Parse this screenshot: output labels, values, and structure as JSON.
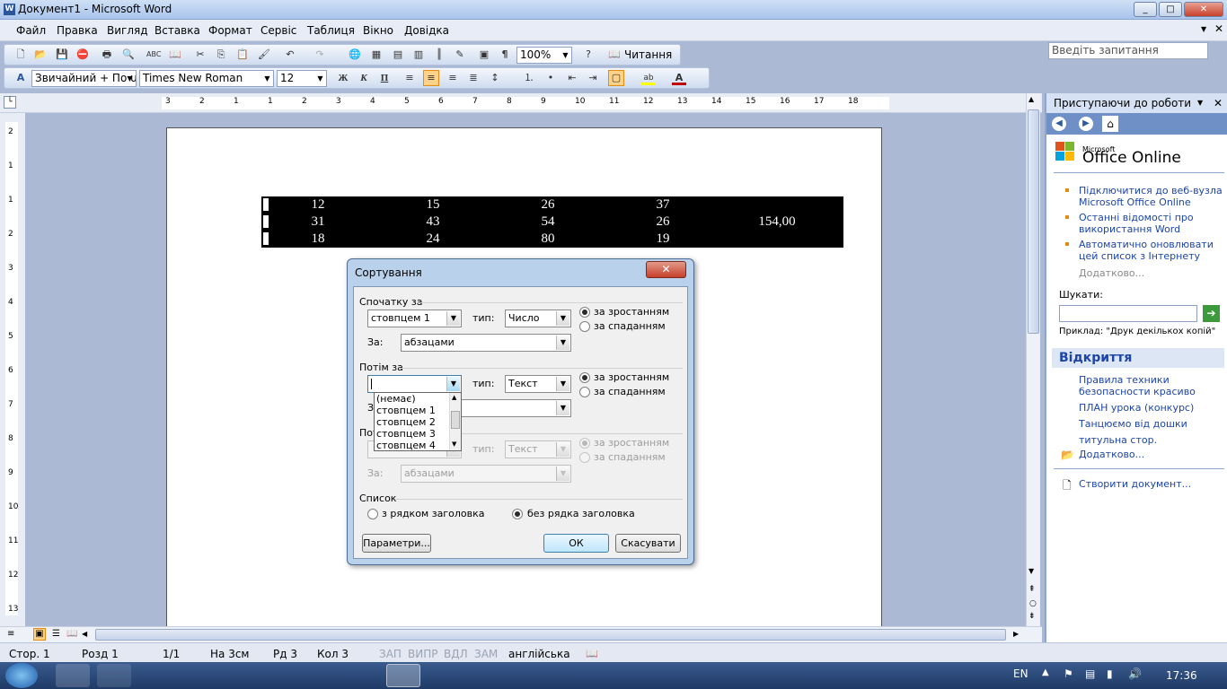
{
  "window": {
    "title": "Документ1 - Microsoft Word"
  },
  "menu": [
    "Файл",
    "Правка",
    "Вигляд",
    "Вставка",
    "Формат",
    "Сервіс",
    "Таблиця",
    "Вікно",
    "Довідка"
  ],
  "ask_box": {
    "placeholder": "Введіть запитання"
  },
  "toolbar": {
    "zoom": "100%",
    "reading": "Читання",
    "style": "Звичайний + По u",
    "font": "Times New Roman",
    "size": "12",
    "bold": "Ж",
    "italic": "К",
    "underline": "П"
  },
  "ruler_labels": [
    "3",
    "2",
    "1",
    "1",
    "2",
    "3",
    "4",
    "5",
    "6",
    "7",
    "8",
    "9",
    "10",
    "11",
    "12",
    "13",
    "14",
    "15",
    "16",
    "17",
    "18"
  ],
  "vruler_labels": [
    "2",
    "1",
    "1",
    "2",
    "3",
    "4",
    "5",
    "6",
    "7",
    "8",
    "9",
    "10",
    "11",
    "12",
    "13"
  ],
  "table": {
    "rows": [
      [
        "12",
        "15",
        "26",
        "37",
        ""
      ],
      [
        "31",
        "43",
        "54",
        "26",
        "154,00"
      ],
      [
        "18",
        "24",
        "80",
        "19",
        ""
      ]
    ]
  },
  "dialog": {
    "title": "Сортування",
    "sort1": {
      "label": "Спочатку за",
      "field": "стовпцем 1",
      "type_label": "тип:",
      "type": "Число",
      "by_label": "За:",
      "by": "абзацами",
      "asc": "за зростанням",
      "desc": "за спаданням"
    },
    "sort2": {
      "label": "Потім за",
      "field": "",
      "type_label": "тип:",
      "type": "Текст",
      "by_label": "З",
      "by": "",
      "asc": "за зростанням",
      "desc": "за спаданням"
    },
    "sort3": {
      "label": "Пот",
      "field": "",
      "type_label": "тип:",
      "type": "Текст",
      "by_label": "За:",
      "by": "абзацами",
      "asc": "за зростанням",
      "desc": "за спаданням"
    },
    "dropdown_options": [
      "(немає)",
      "стовпцем 1",
      "стовпцем 2",
      "стовпцем 3",
      "стовпцем 4"
    ],
    "list": {
      "label": "Список",
      "with_header": "з рядком заголовка",
      "without_header": "без рядка заголовка"
    },
    "buttons": {
      "options": "Параметри...",
      "ok": "ОК",
      "cancel": "Скасувати"
    }
  },
  "taskpane": {
    "title": "Приступаючи до роботи",
    "office_small": "Microsoft",
    "office_big": "Office Online",
    "links": [
      "Підключитися до веб-вузла Microsoft Office Online",
      "Останні відомості про використання Word",
      "Автоматично оновлювати цей список з Інтернету"
    ],
    "more1": "Додатково...",
    "search_label": "Шукати:",
    "example": "Приклад: \"Друк декількох копій\"",
    "open_title": "Відкриття",
    "recent": [
      "Правила техники безопасности красиво",
      "ПЛАН урока (конкурс)",
      "Танцюємо від дошки",
      "титульна стор."
    ],
    "more2": "Додатково...",
    "create": "Створити документ..."
  },
  "status": {
    "page": "Стор. 1",
    "section": "Розд 1",
    "pages": "1/1",
    "at": "На 3см",
    "line": "Рд 3",
    "col": "Кол 3",
    "rec": "ЗАП",
    "trk": "ВИПР",
    "ext": "ВДЛ",
    "ovr": "ЗАМ",
    "lang": "англійська"
  },
  "taskbar": {
    "lang": "EN",
    "time": "17:36"
  }
}
